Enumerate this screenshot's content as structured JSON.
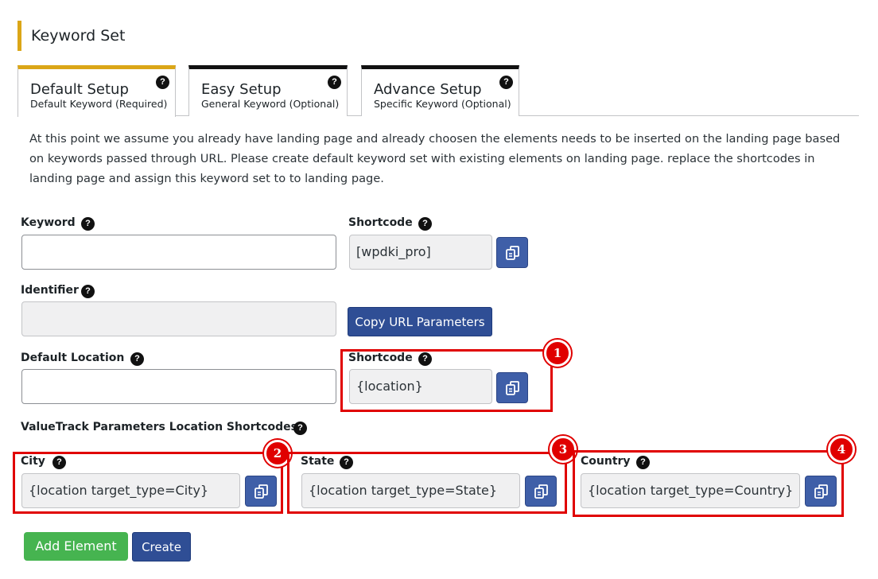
{
  "header": {
    "title": "Keyword Set"
  },
  "tabs": [
    {
      "title": "Default Setup",
      "subtitle": "Default Keyword (Required)",
      "active": true
    },
    {
      "title": "Easy Setup",
      "subtitle": "General Keyword (Optional)",
      "active": false
    },
    {
      "title": "Advance Setup",
      "subtitle": "Specific Keyword (Optional)",
      "active": false
    }
  ],
  "help_glyph": "?",
  "description": "At this point we assume you already have landing page and already choosen the elements needs to be inserted on the landing page based on keywords passed through URL. Please create default keyword set with existing elements on landing page. replace the shortcodes in landing page and assign this keyword set to to landing page.",
  "form": {
    "keyword": {
      "label": "Keyword",
      "value": ""
    },
    "shortcode": {
      "label": "Shortcode",
      "value": "[wpdki_pro]"
    },
    "identifier": {
      "label": "Identifier",
      "value": ""
    },
    "copy_url_button": "Copy URL Parameters",
    "default_location": {
      "label": "Default Location",
      "value": ""
    },
    "location_shortcode": {
      "label": "Shortcode",
      "value": "{location}"
    },
    "valuetrack_label": "ValueTrack Parameters Location Shortcodes",
    "city": {
      "label": "City",
      "value": "{location target_type=City}"
    },
    "state": {
      "label": "State",
      "value": "{location target_type=State}"
    },
    "country": {
      "label": "Country",
      "value": "{location target_type=Country}"
    }
  },
  "buttons": {
    "add_element": "Add Element",
    "create": "Create"
  },
  "annotations": [
    "1",
    "2",
    "3",
    "4"
  ],
  "colors": {
    "accent": "#dba617",
    "primary": "#2f4e95",
    "success": "#46b450",
    "highlight": "#e00000"
  }
}
